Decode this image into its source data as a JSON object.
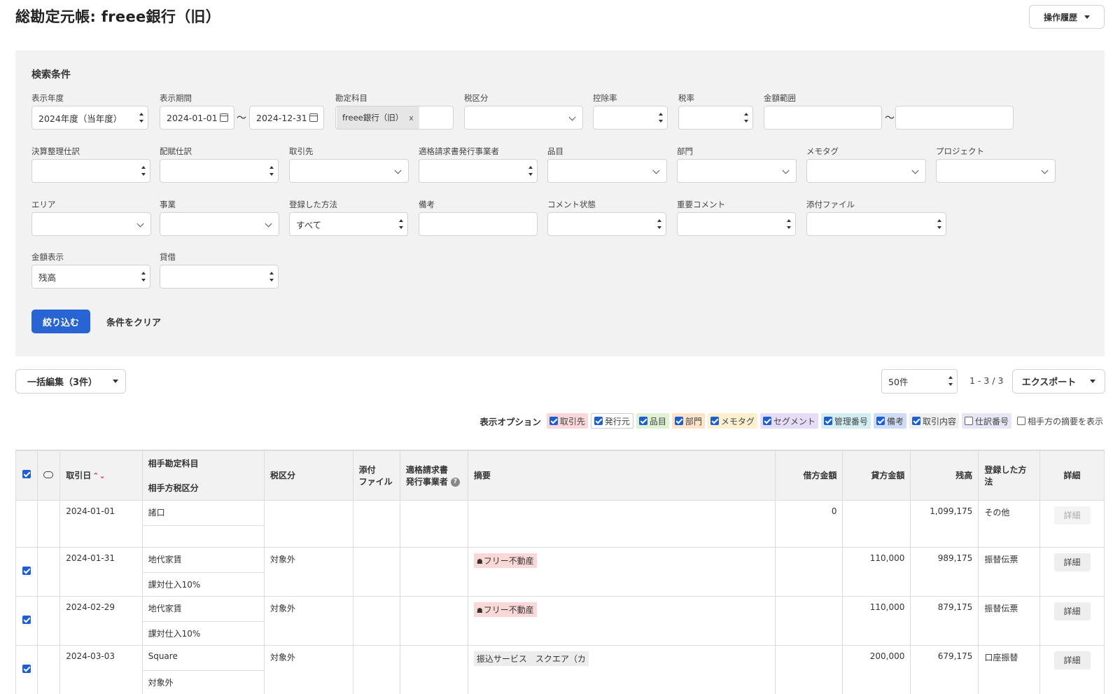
{
  "page": {
    "title": "総勘定元帳: freee銀行（旧）",
    "history_label": "操作履歴"
  },
  "search": {
    "title": "検索条件",
    "fields": {
      "fiscal_year": {
        "label": "表示年度",
        "value": "2024年度（当年度）"
      },
      "period": {
        "label": "表示期間",
        "from": "2024-01-01",
        "to": "2024-12-31",
        "sep": "〜"
      },
      "account": {
        "label": "勘定科目",
        "chip": "freee銀行（旧）",
        "chip_remove": "x"
      },
      "tax_category": {
        "label": "税区分",
        "value": ""
      },
      "deduction_rate": {
        "label": "控除率",
        "value": ""
      },
      "tax_rate": {
        "label": "税率",
        "value": ""
      },
      "amount_range": {
        "label": "金額範囲",
        "sep": "〜"
      },
      "closing_entry": {
        "label": "決算整理仕訳",
        "value": ""
      },
      "allocation_entry": {
        "label": "配賦仕訳",
        "value": ""
      },
      "partner": {
        "label": "取引先",
        "value": ""
      },
      "invoice_issuer": {
        "label": "適格請求書発行事業者",
        "value": ""
      },
      "item": {
        "label": "品目",
        "value": ""
      },
      "department": {
        "label": "部門",
        "value": ""
      },
      "memo_tag": {
        "label": "メモタグ",
        "value": ""
      },
      "project": {
        "label": "プロジェクト",
        "value": ""
      },
      "area": {
        "label": "エリア",
        "value": ""
      },
      "business": {
        "label": "事業",
        "value": ""
      },
      "registration_method": {
        "label": "登録した方法",
        "value": "すべて"
      },
      "remarks": {
        "label": "備考",
        "value": ""
      },
      "comment_status": {
        "label": "コメント状態",
        "value": ""
      },
      "important_comment": {
        "label": "重要コメント",
        "value": ""
      },
      "attachment": {
        "label": "添付ファイル",
        "value": ""
      },
      "amount_display": {
        "label": "金額表示",
        "value": "残高"
      },
      "debit_credit": {
        "label": "貸借",
        "value": ""
      }
    },
    "submit_label": "絞り込む",
    "clear_label": "条件をクリア"
  },
  "toolbar": {
    "bulk_edit_label": "一括編集（3件）",
    "per_page": "50件",
    "pagination": "1 - 3 / 3",
    "export_label": "エクスポート"
  },
  "display_options": {
    "label": "表示オプション",
    "items": [
      {
        "label": "取引先",
        "checked": true,
        "bg": "#fbd8d8"
      },
      {
        "label": "発行元",
        "checked": true,
        "bg": "#ffffff"
      },
      {
        "label": "品目",
        "checked": true,
        "bg": "#dff2d3"
      },
      {
        "label": "部門",
        "checked": true,
        "bg": "#fde3c8"
      },
      {
        "label": "メモタグ",
        "checked": true,
        "bg": "#fdf0cf"
      },
      {
        "label": "セグメント",
        "checked": true,
        "bg": "#e6dcf7"
      },
      {
        "label": "管理番号",
        "checked": true,
        "bg": "#d2eef2"
      },
      {
        "label": "備考",
        "checked": true,
        "bg": "#cfdcf5"
      },
      {
        "label": "取引内容",
        "checked": true,
        "bg": "#f0f0f0"
      },
      {
        "label": "仕訳番号",
        "checked": false,
        "bg": "#e6e6f7"
      },
      {
        "label": "相手方の摘要を表示",
        "checked": false,
        "bg": "#ffffff"
      }
    ]
  },
  "table": {
    "headers": {
      "date": "取引日",
      "counter_account": "相手勘定科目",
      "counter_tax": "相手方税区分",
      "tax_category": "税区分",
      "attachment_1": "添付",
      "attachment_2": "ファイル",
      "invoice_1": "適格請求書",
      "invoice_2": "発行事業者",
      "description": "摘要",
      "debit": "借方金額",
      "credit": "貸方金額",
      "balance": "残高",
      "method_1": "登録した方",
      "method_2": "法",
      "detail": "詳細"
    },
    "rows": [
      {
        "checked": false,
        "date": "2024-01-01",
        "counter_account": "諸口",
        "counter_tax": "",
        "tax": "",
        "tag": "",
        "tag_style": "",
        "debit": "0",
        "credit": "",
        "balance": "1,099,175",
        "method": "その他",
        "detail": "詳細",
        "detail_disabled": true
      },
      {
        "checked": true,
        "date": "2024-01-31",
        "counter_account": "地代家賃",
        "counter_tax": "課対仕入10%",
        "tax": "対象外",
        "tag": "フリー不動産",
        "tag_style": "pink",
        "debit": "",
        "credit": "110,000",
        "balance": "989,175",
        "method": "振替伝票",
        "detail": "詳細",
        "detail_disabled": false
      },
      {
        "checked": true,
        "date": "2024-02-29",
        "counter_account": "地代家賃",
        "counter_tax": "課対仕入10%",
        "tax": "対象外",
        "tag": "フリー不動産",
        "tag_style": "pink",
        "debit": "",
        "credit": "110,000",
        "balance": "879,175",
        "method": "振替伝票",
        "detail": "詳細",
        "detail_disabled": false
      },
      {
        "checked": true,
        "date": "2024-03-03",
        "counter_account": "Square",
        "counter_tax": "対象外",
        "tax": "対象外",
        "tag": "振込サービス　スクエア（カ",
        "tag_style": "gray",
        "debit": "",
        "credit": "200,000",
        "balance": "679,175",
        "method": "口座振替",
        "detail": "詳細",
        "detail_disabled": false
      }
    ]
  },
  "colors": {
    "primary": "#2864d4",
    "panel_bg": "#f2f2f2",
    "checkbox": "#1e5fd0"
  }
}
